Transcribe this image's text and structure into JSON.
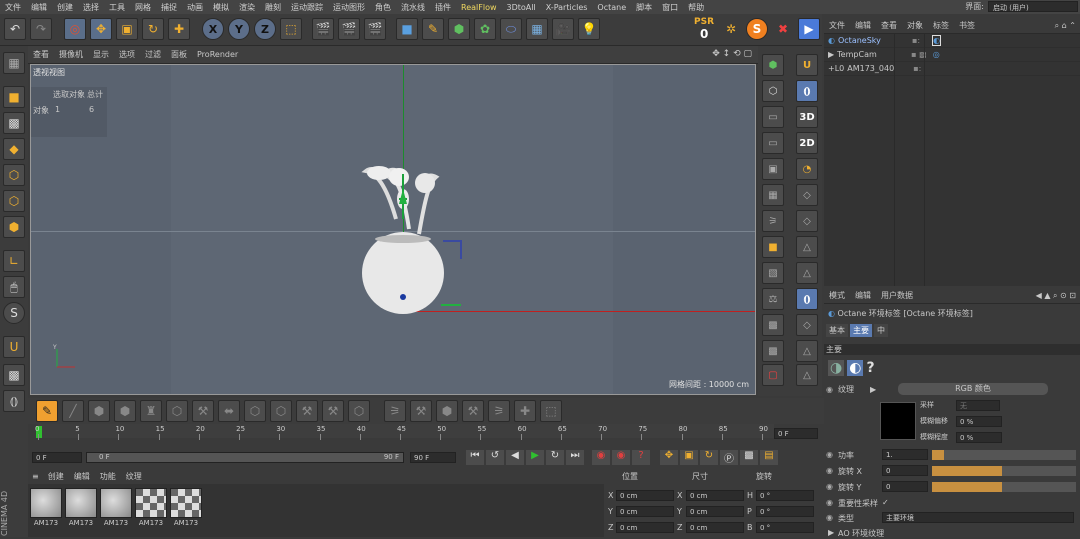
{
  "menu": [
    "文件",
    "编辑",
    "创建",
    "选择",
    "工具",
    "网格",
    "捕捉",
    "动画",
    "模拟",
    "渲染",
    "雕刻",
    "运动跟踪",
    "运动图形",
    "角色",
    "流水线",
    "插件",
    "RealFlow",
    "3DtoAll",
    "X-Particles",
    "Octane",
    "脚本",
    "窗口",
    "帮助"
  ],
  "layout": {
    "label": "界面:",
    "value": "启动 (用户)"
  },
  "toolbar": {
    "psr_label": "PSR",
    "psr_value": "0"
  },
  "viewport_menu": [
    "查看",
    "摄像机",
    "显示",
    "选项",
    "过滤",
    "面板",
    "ProRender"
  ],
  "viewport": {
    "title": "透视视图",
    "stats": {
      "col1": "选取对象",
      "col2": "总计",
      "row_label": "对象",
      "selected": "1",
      "total": "6"
    },
    "grid_info": "网格间距 : 10000 cm"
  },
  "object_manager": {
    "menu": [
      "文件",
      "编辑",
      "查看",
      "对象",
      "标签",
      "书签"
    ],
    "objects": [
      "OctaneSky",
      "TempCam",
      "AM173_040"
    ]
  },
  "attributes": {
    "menu": [
      "模式",
      "编辑",
      "用户数据"
    ],
    "title": "Octane 环境标签 [Octane 环境标签]",
    "tabs": [
      "基本",
      "主要",
      "中"
    ],
    "section": "主要",
    "texture_label": "纹理",
    "texture_value": "RGB 颜色",
    "sampling_label": "采样",
    "sampling_value": "无",
    "blur_offset_label": "模糊偏移",
    "blur_offset_value": "0 %",
    "blur_degree_label": "模糊程度",
    "blur_degree_value": "0 %",
    "power_label": "功率",
    "power_value": "1.",
    "rotx_label": "旋转 X",
    "rotx_value": "0",
    "roty_label": "旋转 Y",
    "roty_value": "0",
    "importance_label": "重要性采样",
    "importance_check": "✓",
    "type_label": "类型",
    "type_value": "主要环境",
    "ao_label": "AO 环境纹理"
  },
  "timeline": {
    "ticks": [
      "0",
      "5",
      "10",
      "15",
      "20",
      "25",
      "30",
      "35",
      "40",
      "45",
      "50",
      "55",
      "60",
      "65",
      "70",
      "75",
      "80",
      "85",
      "90"
    ],
    "end_field": "0 F",
    "start_field": "0 F",
    "range_start": "0 F",
    "range_end": "90 F",
    "max_field": "90 F"
  },
  "materials": {
    "menu": [
      "创建",
      "编辑",
      "功能",
      "纹理"
    ],
    "items": [
      "AM173",
      "AM173",
      "AM173",
      "AM173",
      "AM173"
    ]
  },
  "coords": {
    "headers": [
      "位置",
      "尺寸",
      "旋转"
    ],
    "rows": [
      {
        "a": "X",
        "pos": "0 cm",
        "b": "X",
        "size": "0 cm",
        "c": "H",
        "rot": "0 °"
      },
      {
        "a": "Y",
        "pos": "0 cm",
        "b": "Y",
        "size": "0 cm",
        "c": "P",
        "rot": "0 °"
      },
      {
        "a": "Z",
        "pos": "0 cm",
        "b": "Z",
        "size": "0 cm",
        "c": "B",
        "rot": "0 °"
      }
    ]
  },
  "brand": "CINEMA 4D"
}
